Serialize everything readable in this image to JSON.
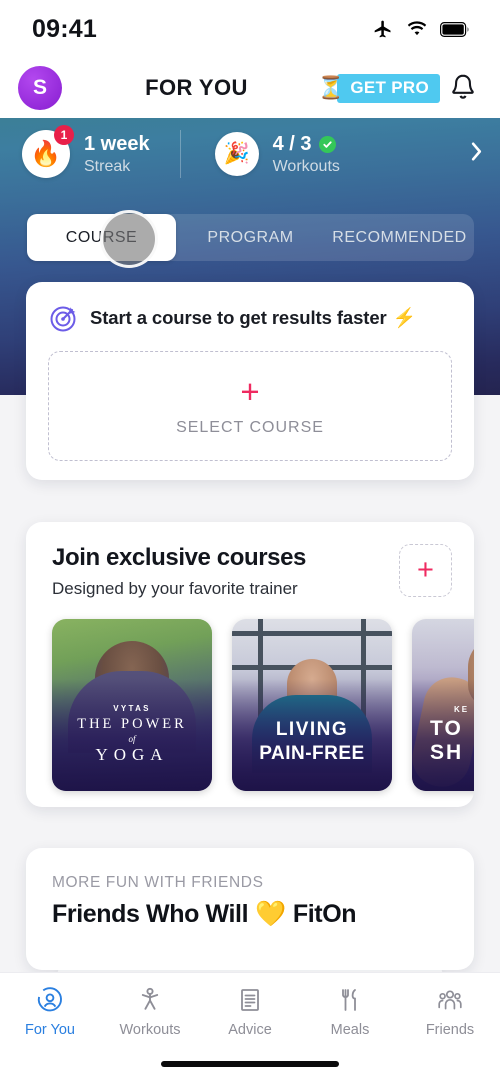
{
  "status_bar": {
    "time": "09:41",
    "icons": [
      "airplane-icon",
      "wifi-icon",
      "battery-icon"
    ]
  },
  "header": {
    "avatar_initial": "S",
    "title": "FOR YOU",
    "get_pro_label": "GET PRO",
    "get_pro_emoji": "⏳",
    "get_pro_bg": "#4fc9f0",
    "bell_icon": "bell-icon"
  },
  "streak_banner": {
    "gradient_from": "#3c7f97",
    "gradient_to": "#242450",
    "streak": {
      "icon": "🔥",
      "badge": "1",
      "value": "1 week",
      "label": "Streak"
    },
    "workouts": {
      "icon": "🎉",
      "value": "4 / 3",
      "label": "Workouts",
      "check_color": "#34c759"
    },
    "chevron": "chevron-right-icon"
  },
  "tabs": [
    {
      "label": "COURSE",
      "active": true
    },
    {
      "label": "PROGRAM",
      "active": false
    },
    {
      "label": "RECOMMENDED",
      "active": false
    }
  ],
  "course_card": {
    "icon": "target-icon",
    "headline": "Start a course to get results faster",
    "headline_emoji": "⚡",
    "plus": "+",
    "select_label": "SELECT COURSE",
    "accent_color": "#ef2a60"
  },
  "exclusive_card": {
    "title": "Join exclusive courses",
    "subtitle": "Designed by your favorite trainer",
    "add_plus": "+",
    "thumbs": [
      {
        "trainer": "VYTAS",
        "line1": "THE POWER",
        "connector": "of",
        "line2": "YOGA"
      },
      {
        "line1": "LIVING",
        "line2": "PAIN-FREE"
      },
      {
        "kicker": "KE",
        "line1": "TO",
        "line2": "SH"
      }
    ]
  },
  "friends_card": {
    "kicker": "MORE FUN WITH FRIENDS",
    "title": "Friends Who Will",
    "emoji": "💛",
    "title_end": "FitOn"
  },
  "bottom_nav": {
    "active_color": "#2a7fe0",
    "items": [
      {
        "label": "For You",
        "icon": "for-you-icon",
        "active": true
      },
      {
        "label": "Workouts",
        "icon": "workouts-icon",
        "active": false
      },
      {
        "label": "Advice",
        "icon": "advice-icon",
        "active": false
      },
      {
        "label": "Meals",
        "icon": "meals-icon",
        "active": false
      },
      {
        "label": "Friends",
        "icon": "friends-icon",
        "active": false
      }
    ]
  }
}
